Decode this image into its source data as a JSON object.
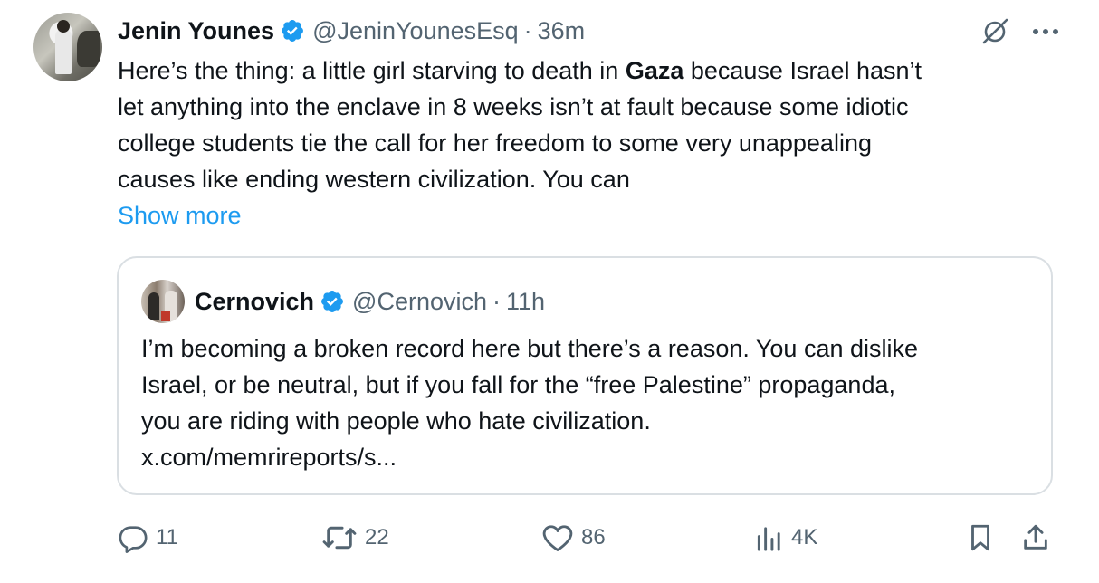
{
  "tweet": {
    "author_name": "Jenin Younes",
    "handle": "@JeninYounesEsq",
    "separator": "·",
    "time": "36m",
    "text_before_bold": "Here’s the thing: a little girl starving to death in ",
    "text_bold": "Gaza",
    "text_after_bold": " because Israel hasn’t\nlet anything into the enclave in 8 weeks isn’t at fault because some idiotic\ncollege students tie the call for her freedom to some very unappealing\ncauses like ending western civilization. You can",
    "show_more_label": "Show more"
  },
  "quoted_tweet": {
    "author_name": "Cernovich",
    "handle": "@Cernovich",
    "separator": "·",
    "time": "11h",
    "text": "I’m becoming a broken record here but there’s a reason. You can dislike\nIsrael, or be neutral, but if you fall for the “free Palestine” propaganda,\nyou are riding with people who hate civilization.\nx.com/memrireports/s..."
  },
  "actions": {
    "replies": "11",
    "reposts": "22",
    "likes": "86",
    "views": "4K"
  },
  "icons": {
    "verified": "verified-badge-icon",
    "grok": "grok-icon",
    "more": "more-icon",
    "reply": "reply-icon",
    "repost": "repost-icon",
    "like": "heart-icon",
    "views": "views-icon",
    "bookmark": "bookmark-icon",
    "share": "share-icon"
  },
  "colors": {
    "link_blue": "#1d9bf0",
    "muted_gray": "#536471",
    "verified_blue": "#1d9bf0"
  }
}
